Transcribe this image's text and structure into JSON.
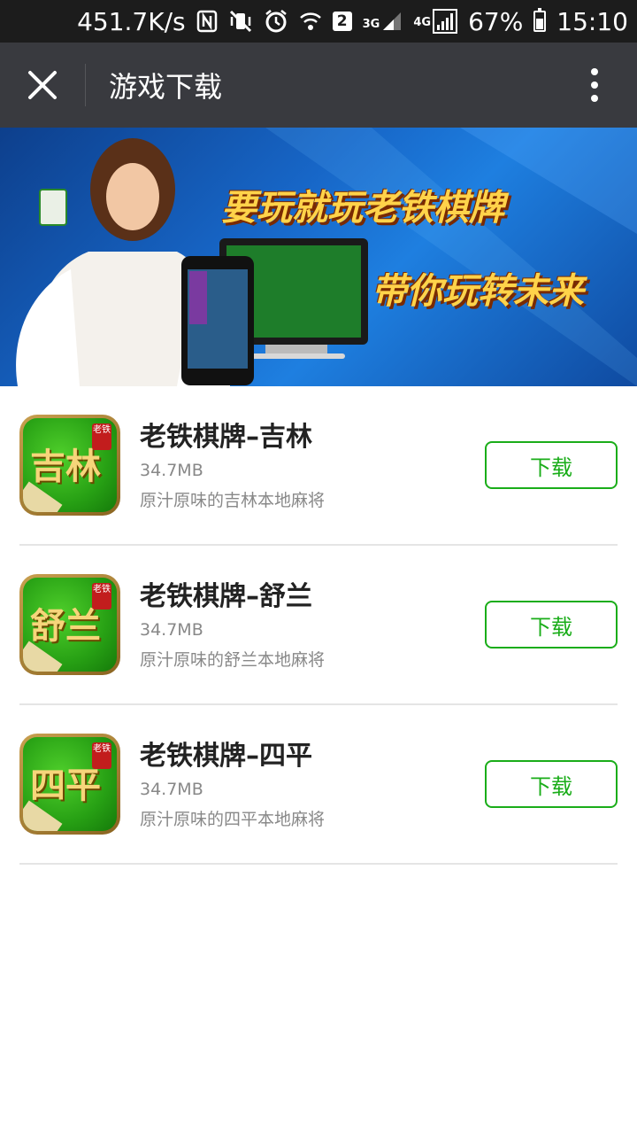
{
  "status_bar": {
    "speed": "451.7K/s",
    "net_3g": "3G",
    "net_4g": "4G",
    "sim_badge": "2",
    "battery": "67%",
    "time": "15:10"
  },
  "header": {
    "title": "游戏下载"
  },
  "banner": {
    "line1": "要玩就玩老铁棋牌",
    "line2": "带你玩转未来"
  },
  "apps": [
    {
      "name": "老铁棋牌–吉林",
      "size": "34.7MB",
      "desc": "原汁原味的吉林本地麻将",
      "icon_text": "吉林",
      "download_label": "下载"
    },
    {
      "name": "老铁棋牌–舒兰",
      "size": "34.7MB",
      "desc": "原汁原味的舒兰本地麻将",
      "icon_text": "舒兰",
      "download_label": "下载"
    },
    {
      "name": "老铁棋牌–四平",
      "size": "34.7MB",
      "desc": "原汁原味的四平本地麻将",
      "icon_text": "四平",
      "download_label": "下载"
    }
  ],
  "icon_tag": "老铁",
  "colors": {
    "accent": "#1aad19",
    "header_bg": "#393a3f",
    "status_bg": "#1c1c1c"
  }
}
